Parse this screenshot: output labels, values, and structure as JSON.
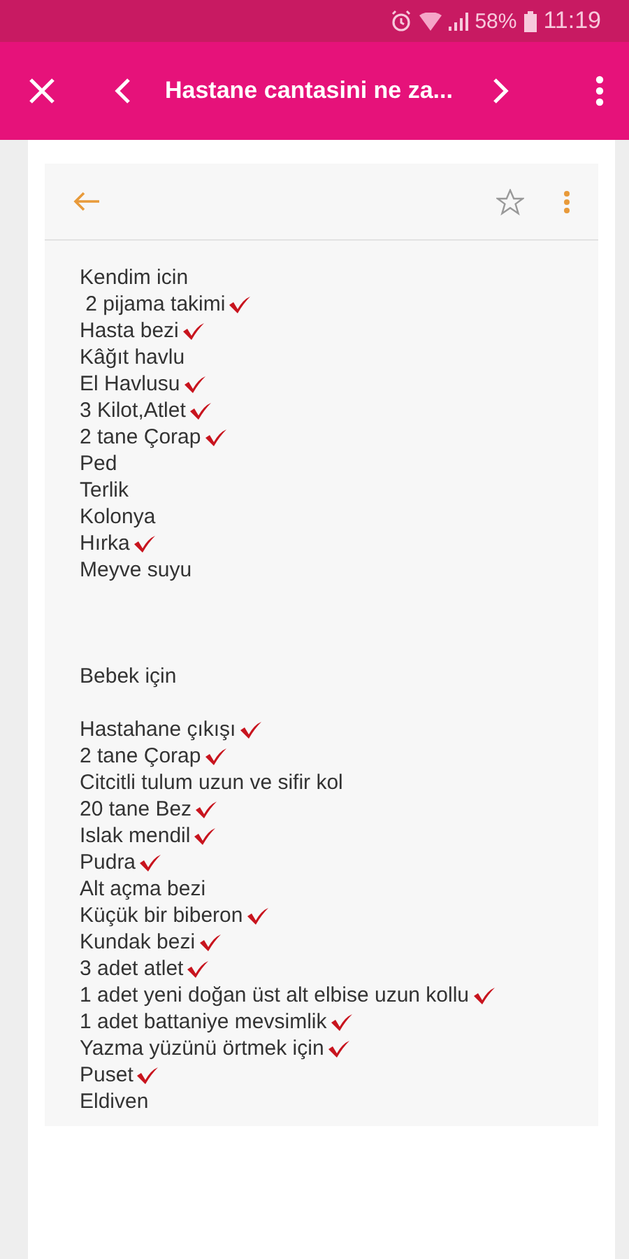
{
  "status_bar": {
    "battery": "58%",
    "time": "11:19"
  },
  "toolbar": {
    "title": "Hastane cantasini ne za..."
  },
  "note": {
    "sections": [
      {
        "heading": "Kendim icin",
        "items": [
          {
            "text": " 2 pijama takimi",
            "checked": true
          },
          {
            "text": "Hasta bezi",
            "checked": true
          },
          {
            "text": "Kâğıt havlu",
            "checked": false
          },
          {
            "text": "El Havlusu",
            "checked": true
          },
          {
            "text": "3 Kilot,Atlet",
            "checked": true
          },
          {
            "text": "2 tane Çorap",
            "checked": true
          },
          {
            "text": "Ped",
            "checked": false
          },
          {
            "text": "Terlik",
            "checked": false
          },
          {
            "text": "Kolonya",
            "checked": false
          },
          {
            "text": "Hırka",
            "checked": true
          },
          {
            "text": "Meyve suyu",
            "checked": false
          }
        ]
      },
      {
        "heading": "Bebek için",
        "items": [
          {
            "text": "Hastahane çıkışı",
            "checked": true
          },
          {
            "text": "2 tane Çorap",
            "checked": true
          },
          {
            "text": "Citcitli tulum uzun ve sifir kol",
            "checked": false
          },
          {
            "text": "20 tane Bez",
            "checked": true
          },
          {
            "text": "Islak mendil",
            "checked": true
          },
          {
            "text": "Pudra",
            "checked": true
          },
          {
            "text": "Alt açma bezi",
            "checked": false
          },
          {
            "text": "Küçük bir biberon",
            "checked": true
          },
          {
            "text": "Kundak bezi",
            "checked": true
          },
          {
            "text": "3 adet atlet",
            "checked": true
          },
          {
            "text": "1 adet yeni doğan üst alt elbise uzun kollu",
            "checked": true
          },
          {
            "text": "1 adet battaniye mevsimlik",
            "checked": true
          },
          {
            "text": "Yazma yüzünü örtmek için",
            "checked": true
          },
          {
            "text": "Puset",
            "checked": true
          },
          {
            "text": "Eldiven",
            "checked": false
          }
        ]
      }
    ]
  }
}
